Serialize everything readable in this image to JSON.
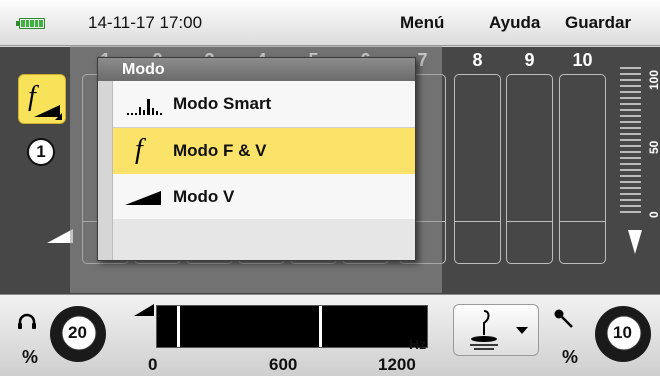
{
  "header": {
    "datetime": "14-11-17 17:00",
    "menu_label": "Menú",
    "help_label": "Ayuda",
    "save_label": "Guardar",
    "battery_color": "#3fb13f"
  },
  "channels": {
    "labels": [
      "1",
      "2",
      "3",
      "4",
      "5",
      "6",
      "7",
      "8",
      "9",
      "10"
    ]
  },
  "mode_button": {
    "icon": "f-v-mode-icon",
    "badge": "1",
    "accent": "#f8e25a"
  },
  "scale": {
    "label_top": "100",
    "label_mid": "50",
    "label_bottom": "0"
  },
  "mode_dropdown": {
    "title": "Modo",
    "items": [
      {
        "label": "Modo Smart",
        "icon": "smart-mode-icon"
      },
      {
        "label": "Modo F & V",
        "icon": "f-mode-icon",
        "selected": true
      },
      {
        "label": "Modo V",
        "icon": "v-mode-icon"
      }
    ]
  },
  "bottom": {
    "volume_value": "20",
    "volume_unit": "%",
    "freq_ticks": [
      "0",
      "600",
      "1200"
    ],
    "freq_unit": "Hz",
    "sensitivity_value": "10",
    "sensitivity_unit": "%"
  }
}
